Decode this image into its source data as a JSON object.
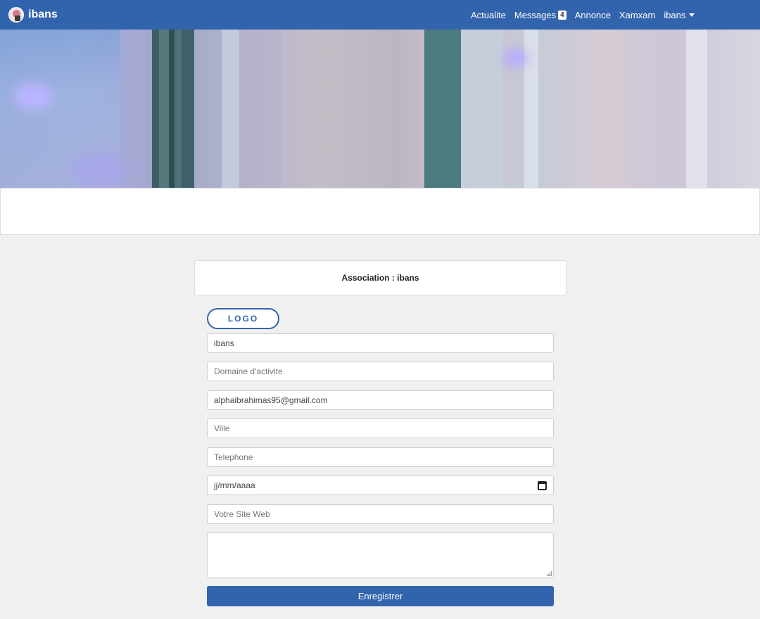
{
  "navbar": {
    "brand": "ibans",
    "items": [
      {
        "label": "Actualite"
      },
      {
        "label": "Messages",
        "badge": "4"
      },
      {
        "label": "Annonce"
      },
      {
        "label": "Xamxam"
      },
      {
        "label": "ibans",
        "dropdown": true
      }
    ]
  },
  "card": {
    "title": "Association : ibans"
  },
  "form": {
    "logo_label": "LOGO",
    "name_value": "ibans",
    "domain_placeholder": "Domaine d'activite",
    "email_value": "alphaibrahimas95@gmail.com",
    "city_placeholder": "Ville",
    "phone_placeholder": "Telephone",
    "date_placeholder": "jj/mm/aaaa",
    "website_placeholder": "Votre Site Web",
    "description_value": "",
    "submit_label": "Enregistrer"
  },
  "colors": {
    "primary": "#3264ad",
    "background": "#f0f0f0"
  },
  "icons": {
    "brand": "avatar-logo-icon",
    "dropdown": "caret-down-icon",
    "date": "calendar-icon",
    "resize": "resize-handle-icon"
  }
}
